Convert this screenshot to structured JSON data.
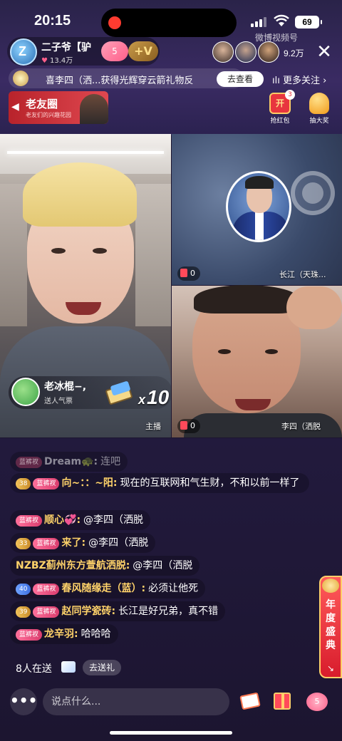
{
  "status_bar": {
    "time": "20:15",
    "battery": "69"
  },
  "host": {
    "name": "二子爷【驴",
    "likes": "13.4万",
    "gift_badge": "5",
    "follow_badge": "+V"
  },
  "viewers": {
    "count": "9.2万",
    "watermark": "微博视频号"
  },
  "marquee": {
    "text": "喜李四（洒...获得光辉穿云箭礼物反",
    "see_button": "去查看",
    "more_follow": "更多关注"
  },
  "friend_circle": {
    "title": "老友圈",
    "subtitle": "老友们的兴趣花园"
  },
  "activities": {
    "red_packet_label": "抢红包",
    "red_packet_count": "3",
    "red_packet_glyph": "开",
    "lottery_label": "抽大奖"
  },
  "video": {
    "gift_user": "老冰棍−,",
    "gift_action": "送人气票",
    "gift_x": "x",
    "gift_multiplier": "10",
    "anchor_label": "主播",
    "seat1_count": "0",
    "seat1_name": "长江（天珠...",
    "seat2_count": "0",
    "seat2_name": "李四（洒脱"
  },
  "chat": [
    {
      "level": "",
      "badge": "蓝裤衩",
      "name": "Dream🐢:",
      "msg": "连吧",
      "dim": true
    },
    {
      "level": "38",
      "badge": "蓝裤衩",
      "name": "向~：：~阳:",
      "msg": "现在的互联网和气生财，不和以前一样了"
    },
    {
      "level": "",
      "badge": "蓝裤衩",
      "name": "顺心💞:",
      "msg": "@李四（洒脱"
    },
    {
      "level": "33",
      "badge": "蓝裤衩",
      "name": "来了:",
      "msg": "@李四（洒脱"
    },
    {
      "level": "",
      "badge": "",
      "name": "NZBZ蓟州东方萱航洒脱:",
      "msg": "@李四（洒脱"
    },
    {
      "level": "40",
      "badge": "蓝裤衩",
      "name": "春风随缘走（蓝）:",
      "msg": "必须让他死"
    },
    {
      "level": "39",
      "badge": "蓝裤衩",
      "name": "赵同学瓷砖:",
      "msg": "长江是好兄弟，真不错"
    },
    {
      "level": "",
      "badge": "蓝裤衩",
      "name": "龙辛羽:",
      "msg": "哈哈哈"
    }
  ],
  "promo": {
    "text": "年度盛典"
  },
  "senders": {
    "text": "8人在送",
    "button": "去送礼"
  },
  "bottom_bar": {
    "more": "•••",
    "input_placeholder": "说点什么...",
    "heart_badge": "5"
  }
}
